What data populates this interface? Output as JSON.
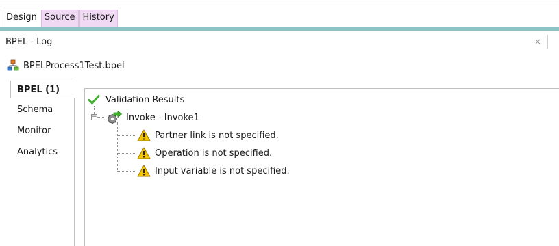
{
  "editor_tabs": [
    {
      "label": "Design",
      "active": true
    },
    {
      "label": "Source",
      "highlighted": true
    },
    {
      "label": "History",
      "highlighted": true
    }
  ],
  "log": {
    "title": "BPEL - Log",
    "close_glyph": "×"
  },
  "file": {
    "name": "BPELProcess1Test.bpel",
    "icon": "bpel-process-icon"
  },
  "side_tabs": [
    {
      "label": "BPEL (1)",
      "active": true
    },
    {
      "label": "Schema"
    },
    {
      "label": "Monitor"
    },
    {
      "label": "Analytics"
    }
  ],
  "results": {
    "root": {
      "label": "Validation Results",
      "icon": "checkmark-icon"
    },
    "node": {
      "label": "Invoke - Invoke1",
      "icon": "invoke-activity-icon",
      "expanded": true
    },
    "warnings": [
      {
        "label": "Partner link is not specified.",
        "icon": "warning-icon"
      },
      {
        "label": "Operation is not specified.",
        "icon": "warning-icon"
      },
      {
        "label": "Input variable is not specified.",
        "icon": "warning-icon"
      }
    ]
  },
  "colors": {
    "teal_bar": "#8cc4c6",
    "tab_highlight": "#f0daf3",
    "check_green": "#3fae2a",
    "warning_yellow": "#f5c400"
  }
}
